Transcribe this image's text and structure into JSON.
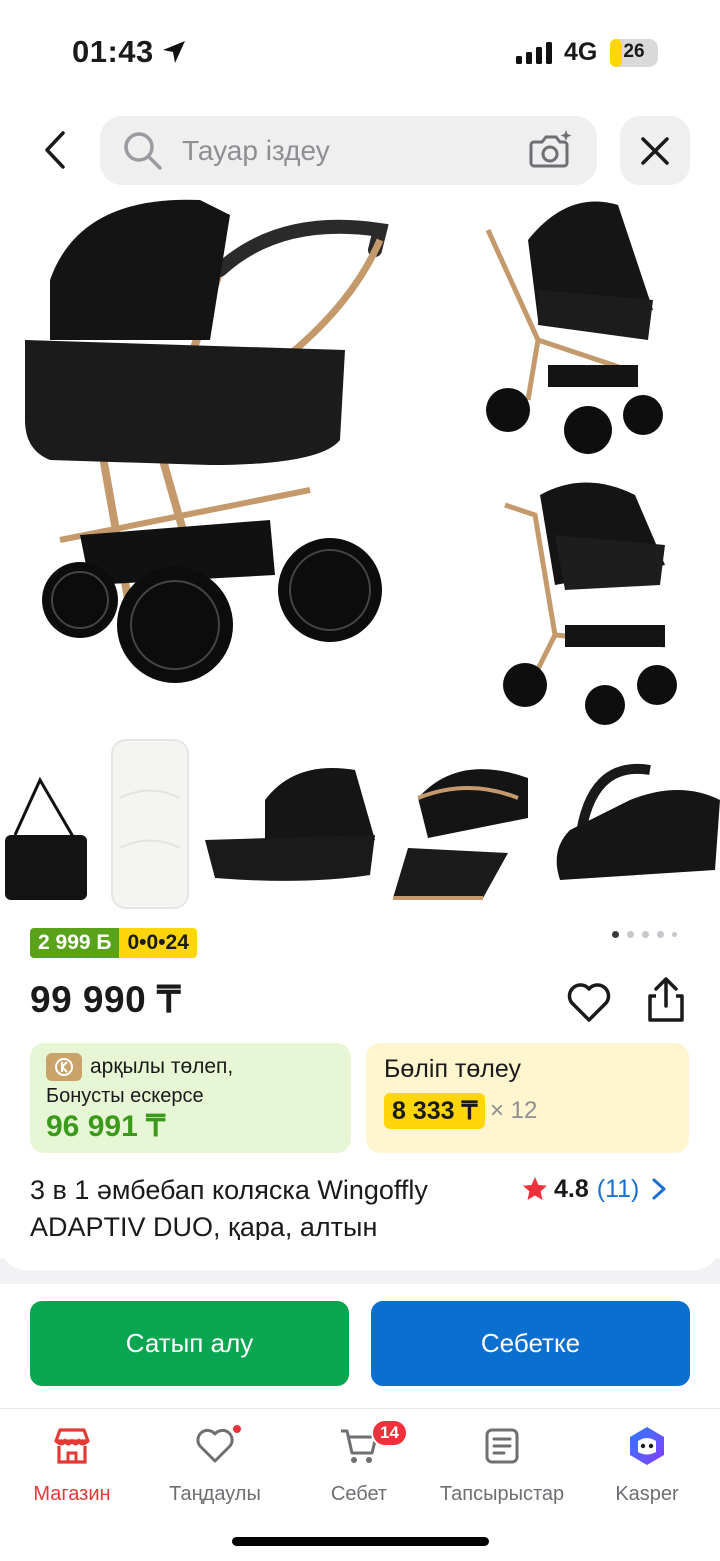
{
  "status_bar": {
    "time": "01:43",
    "network": "4G",
    "battery": "26",
    "battery_level": 0.26
  },
  "search": {
    "placeholder": "Тауар іздеу"
  },
  "promo": {
    "bonus_badge": "2 999 Б",
    "installment_badge": "0•0•24"
  },
  "gallery": {
    "page_count": 5,
    "current_page": 1
  },
  "product": {
    "price": "99 990 ₸",
    "title": "3 в 1 әмбебап коляска Wingoffly ADAPTIV DUO, қара, алтын",
    "rating": "4.8",
    "reviews": "(11)"
  },
  "kaspi_card": {
    "line1": "арқылы төлеп,",
    "line2": "Бонусты ескерсе",
    "amount": "96 991 ₸"
  },
  "installment_card": {
    "title": "Бөліп төлеу",
    "amount": "8 333 ₸",
    "multiplier": "× 12"
  },
  "actions": {
    "buy": "Сатып алу",
    "cart": "Себетке"
  },
  "tabbar": {
    "items": [
      {
        "label": "Магазин",
        "icon": "shop-icon",
        "active": true
      },
      {
        "label": "Таңдаулы",
        "icon": "heart-icon"
      },
      {
        "label": "Себет",
        "icon": "cart-icon",
        "badge": "14"
      },
      {
        "label": "Тапсырыстар",
        "icon": "orders-icon"
      },
      {
        "label": "Kasper",
        "icon": "kasper-icon"
      }
    ]
  },
  "colors": {
    "accent_red": "#e53935",
    "buy_green": "#08a651",
    "cart_blue": "#0a6fcf",
    "yellow": "#ffd60a"
  }
}
